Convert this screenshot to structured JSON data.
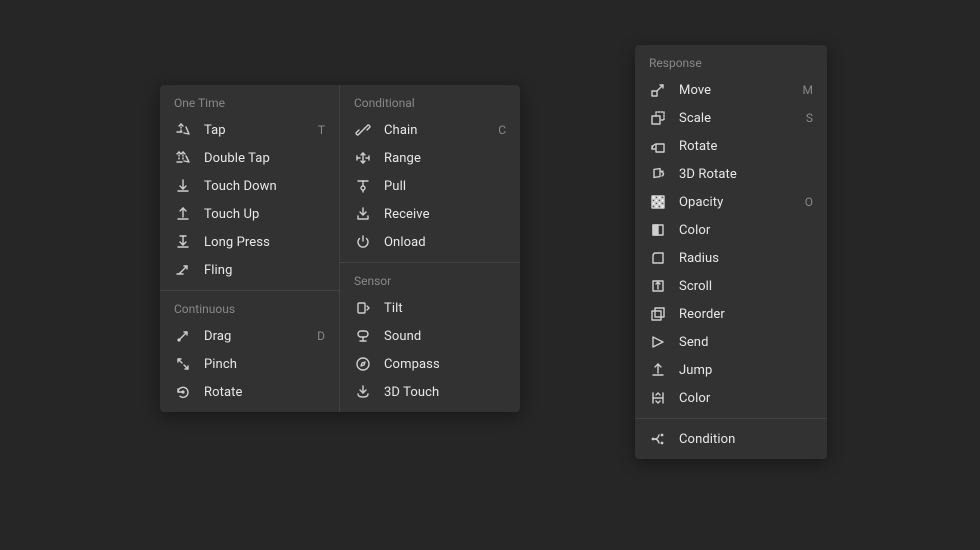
{
  "triggers": {
    "one_time": {
      "title": "One Time",
      "items": [
        {
          "label": "Tap",
          "shortcut": "T",
          "icon": "tap"
        },
        {
          "label": "Double Tap",
          "shortcut": "",
          "icon": "double-tap"
        },
        {
          "label": "Touch Down",
          "shortcut": "",
          "icon": "touch-down"
        },
        {
          "label": "Touch Up",
          "shortcut": "",
          "icon": "touch-up"
        },
        {
          "label": "Long Press",
          "shortcut": "",
          "icon": "long-press"
        },
        {
          "label": "Fling",
          "shortcut": "",
          "icon": "fling"
        }
      ]
    },
    "continuous": {
      "title": "Continuous",
      "items": [
        {
          "label": "Drag",
          "shortcut": "D",
          "icon": "drag"
        },
        {
          "label": "Pinch",
          "shortcut": "",
          "icon": "pinch"
        },
        {
          "label": "Rotate",
          "shortcut": "",
          "icon": "rotate"
        }
      ]
    },
    "conditional": {
      "title": "Conditional",
      "items": [
        {
          "label": "Chain",
          "shortcut": "C",
          "icon": "chain"
        },
        {
          "label": "Range",
          "shortcut": "",
          "icon": "range"
        },
        {
          "label": "Pull",
          "shortcut": "",
          "icon": "pull"
        },
        {
          "label": "Receive",
          "shortcut": "",
          "icon": "receive"
        },
        {
          "label": "Onload",
          "shortcut": "",
          "icon": "onload"
        }
      ]
    },
    "sensor": {
      "title": "Sensor",
      "items": [
        {
          "label": "Tilt",
          "shortcut": "",
          "icon": "tilt"
        },
        {
          "label": "Sound",
          "shortcut": "",
          "icon": "sound"
        },
        {
          "label": "Compass",
          "shortcut": "",
          "icon": "compass"
        },
        {
          "label": "3D Touch",
          "shortcut": "",
          "icon": "3d-touch"
        }
      ]
    }
  },
  "response": {
    "title": "Response",
    "items": [
      {
        "label": "Move",
        "shortcut": "M",
        "icon": "move"
      },
      {
        "label": "Scale",
        "shortcut": "S",
        "icon": "scale"
      },
      {
        "label": "Rotate",
        "shortcut": "",
        "icon": "rotate-resp"
      },
      {
        "label": "3D Rotate",
        "shortcut": "",
        "icon": "3d-rotate"
      },
      {
        "label": "Opacity",
        "shortcut": "O",
        "icon": "opacity"
      },
      {
        "label": "Color",
        "shortcut": "",
        "icon": "color"
      },
      {
        "label": "Radius",
        "shortcut": "",
        "icon": "radius"
      },
      {
        "label": "Scroll",
        "shortcut": "",
        "icon": "scroll"
      },
      {
        "label": "Reorder",
        "shortcut": "",
        "icon": "reorder"
      },
      {
        "label": "Send",
        "shortcut": "",
        "icon": "send"
      },
      {
        "label": "Jump",
        "shortcut": "",
        "icon": "jump"
      },
      {
        "label": "Color",
        "shortcut": "",
        "icon": "color2"
      }
    ],
    "condition": {
      "label": "Condition",
      "icon": "condition"
    }
  }
}
